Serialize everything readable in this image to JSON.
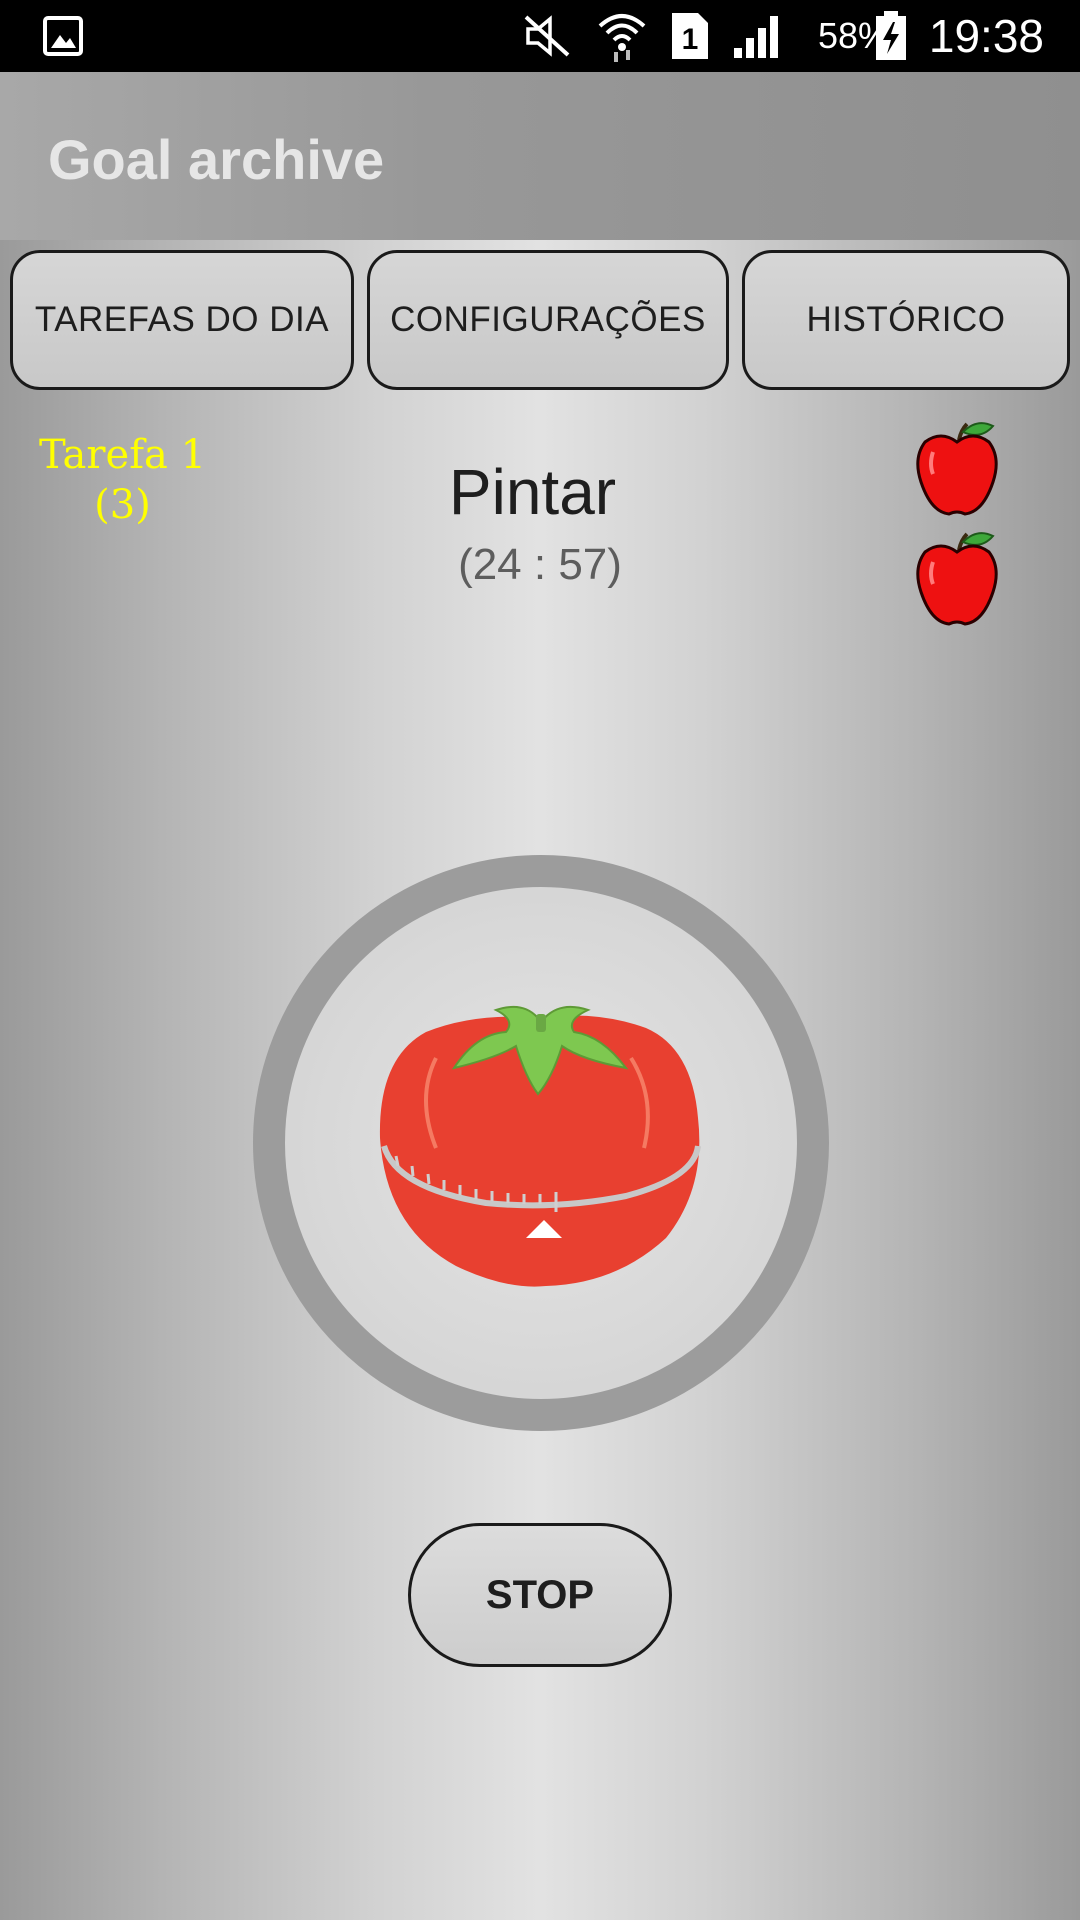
{
  "status_bar": {
    "battery_percent": "58%",
    "time": "19:38",
    "sim_slot": "1",
    "icons": [
      "gallery-icon",
      "mute-icon",
      "wifi-icon",
      "sim-icon",
      "signal-icon",
      "battery-charging-icon"
    ]
  },
  "app_bar": {
    "title": "Goal archive"
  },
  "tabs": [
    {
      "label": "TAREFAS DO DIA"
    },
    {
      "label": "CONFIGURAÇÕES"
    },
    {
      "label": "HISTÓRICO"
    }
  ],
  "task": {
    "label_line1": "Tarefa 1",
    "label_line2": "(3)",
    "name": "Pintar",
    "timer": "(24 : 57)",
    "completed_icons": [
      "apple-icon",
      "apple-icon"
    ]
  },
  "timer_dial": {
    "icon": "tomato-timer-icon"
  },
  "stop_button": {
    "label": "STOP"
  },
  "colors": {
    "task_label": "#ffff00",
    "app_bar_title": "#e6e6e6",
    "ring": "#9c9c9c",
    "tomato": "#e84030",
    "leaf": "#7ec850",
    "apple": "#ee1111"
  }
}
